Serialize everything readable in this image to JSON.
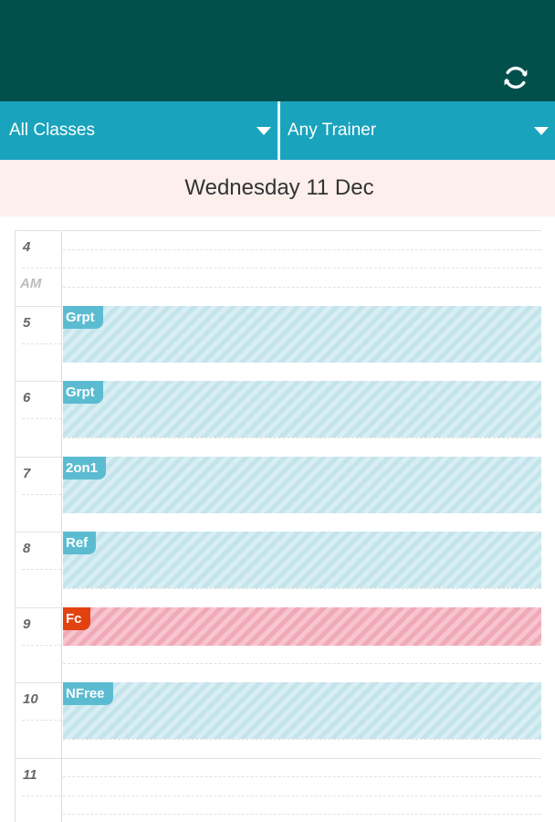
{
  "filters": {
    "classes": "All Classes",
    "trainer": "Any Trainer"
  },
  "date": "Wednesday 11 Dec",
  "hours": [
    {
      "label": "4",
      "suffix": "AM"
    },
    {
      "label": "5"
    },
    {
      "label": "6"
    },
    {
      "label": "7"
    },
    {
      "label": "8"
    },
    {
      "label": "9"
    },
    {
      "label": "10"
    },
    {
      "label": "11"
    }
  ],
  "events": [
    {
      "label": "Grpt",
      "color": "teal"
    },
    {
      "label": "Grpt",
      "color": "teal"
    },
    {
      "label": "2on1",
      "color": "teal"
    },
    {
      "label": "Ref",
      "color": "teal"
    },
    {
      "label": "Fc",
      "color": "red"
    },
    {
      "label": "NFree",
      "color": "teal"
    }
  ],
  "colors": {
    "header": "#02504c",
    "filter_bar": "#1aa3bd",
    "date_bar": "#fcefec",
    "event_teal": "#5bbcd1",
    "event_red": "#e2420f"
  }
}
